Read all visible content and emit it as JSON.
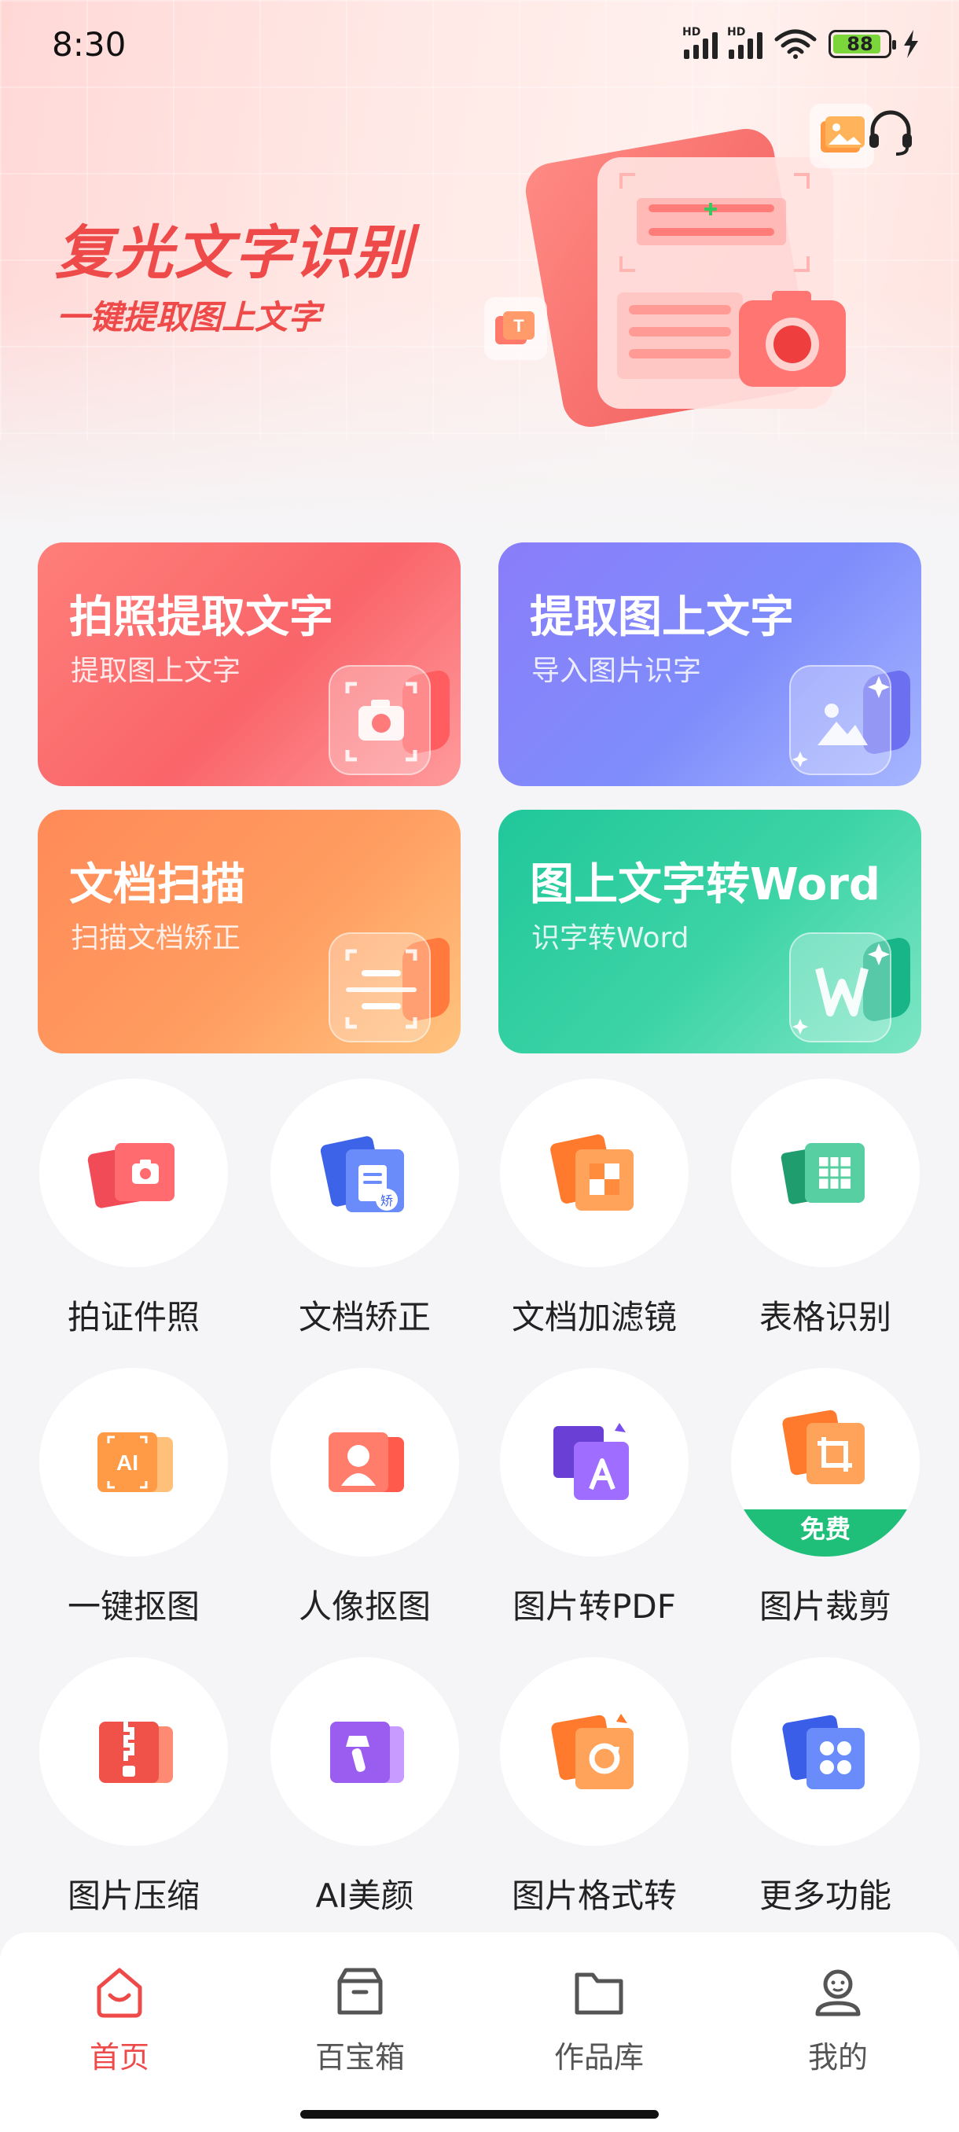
{
  "status_bar": {
    "time": "8:30",
    "signal1_label": "HD",
    "signal2_label": "HD",
    "battery": "88"
  },
  "hero": {
    "title": "复光文字识别",
    "subtitle": "一键提取图上文字",
    "accent_color": "#ee4a4a"
  },
  "feature_cards": [
    {
      "title": "拍照提取文字",
      "subtitle": "提取图上文字",
      "icon": "camera-icon"
    },
    {
      "title": "提取图上文字",
      "subtitle": "导入图片识字",
      "icon": "image-icon"
    },
    {
      "title": "文档扫描",
      "subtitle": "扫描文档矫正",
      "icon": "scan-icon"
    },
    {
      "title": "图上文字转Word",
      "subtitle": "识字转Word",
      "icon": "word-icon"
    }
  ],
  "tools": [
    {
      "label": "拍证件照",
      "icon": "id-photo-camera-icon"
    },
    {
      "label": "文档矫正",
      "icon": "document-correct-icon",
      "icon_text": "矫"
    },
    {
      "label": "文档加滤镜",
      "icon": "document-filter-icon"
    },
    {
      "label": "表格识别",
      "icon": "table-icon"
    },
    {
      "label": "一键抠图",
      "icon": "ai-cutout-icon",
      "icon_text": "AI"
    },
    {
      "label": "人像抠图",
      "icon": "portrait-cutout-icon"
    },
    {
      "label": "图片转PDF",
      "icon": "pdf-icon"
    },
    {
      "label": "图片裁剪",
      "icon": "crop-icon",
      "badge": "免费"
    },
    {
      "label": "图片压缩",
      "icon": "zip-icon"
    },
    {
      "label": "AI美颜",
      "icon": "beauty-brush-icon"
    },
    {
      "label": "图片格式转",
      "icon": "format-convert-icon"
    },
    {
      "label": "更多功能",
      "icon": "more-grid-icon"
    }
  ],
  "bottom_nav": [
    {
      "label": "首页",
      "icon": "home-icon",
      "active": true
    },
    {
      "label": "百宝箱",
      "icon": "toolbox-icon",
      "active": false
    },
    {
      "label": "作品库",
      "icon": "folder-icon",
      "active": false
    },
    {
      "label": "我的",
      "icon": "profile-icon",
      "active": false
    }
  ]
}
